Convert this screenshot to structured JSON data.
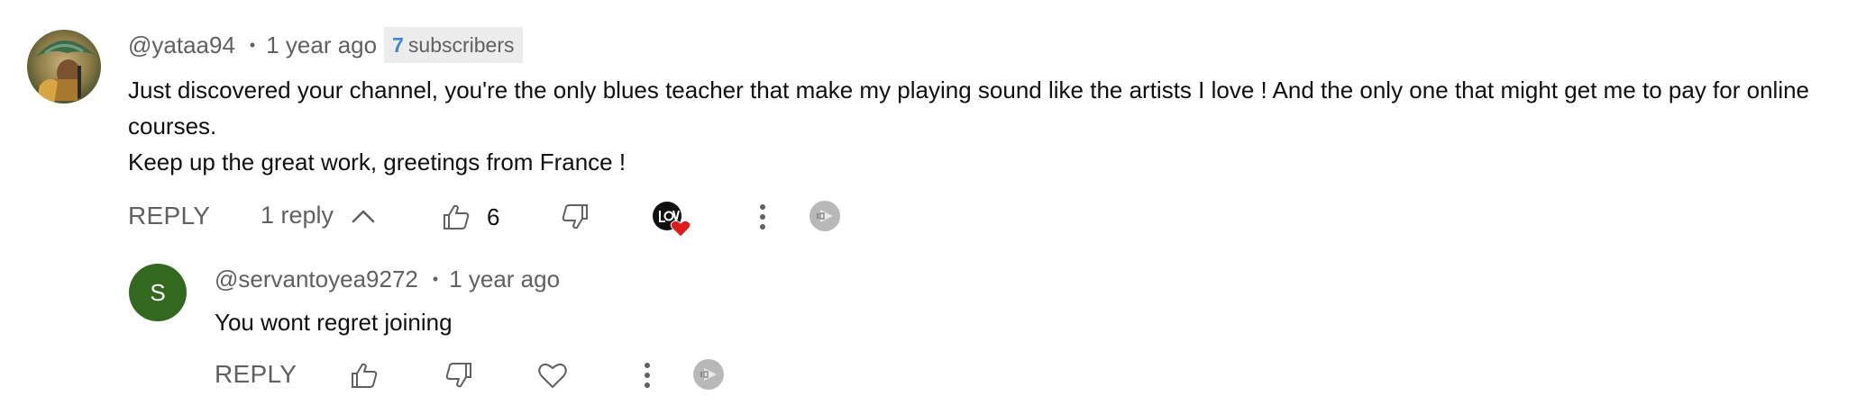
{
  "comment": {
    "author_handle": "@yataa94",
    "separator": "•",
    "time": "1 year ago",
    "badge": {
      "count": "7",
      "label": "subscribers"
    },
    "text_line1": "Just discovered your channel, you're the only blues teacher that make my playing sound like the artists I love ! And the only one that might get me to pay for online",
    "text_line2": "courses.",
    "text_line3": "Keep up the great work, greetings from France !",
    "actions": {
      "reply_label": "REPLY",
      "replies_label": "1 reply",
      "like_count": "6"
    }
  },
  "reply": {
    "avatar_letter": "S",
    "author_handle": "@servantoyea9272",
    "separator": "•",
    "time": "1 year ago",
    "text": "You wont regret joining",
    "actions": {
      "reply_label": "REPLY"
    }
  },
  "colors": {
    "muted_text": "#606060",
    "badge_bg": "#ececec",
    "badge_count": "#3a87d6",
    "reply_avatar_bg": "#33691e",
    "heart_red": "#e01b1b"
  },
  "icons": [
    "thumbs-up-icon",
    "thumbs-down-icon",
    "chevron-up-icon",
    "more-vert-icon",
    "creator-heart-icon",
    "heart-outline-icon",
    "extension-icon"
  ]
}
